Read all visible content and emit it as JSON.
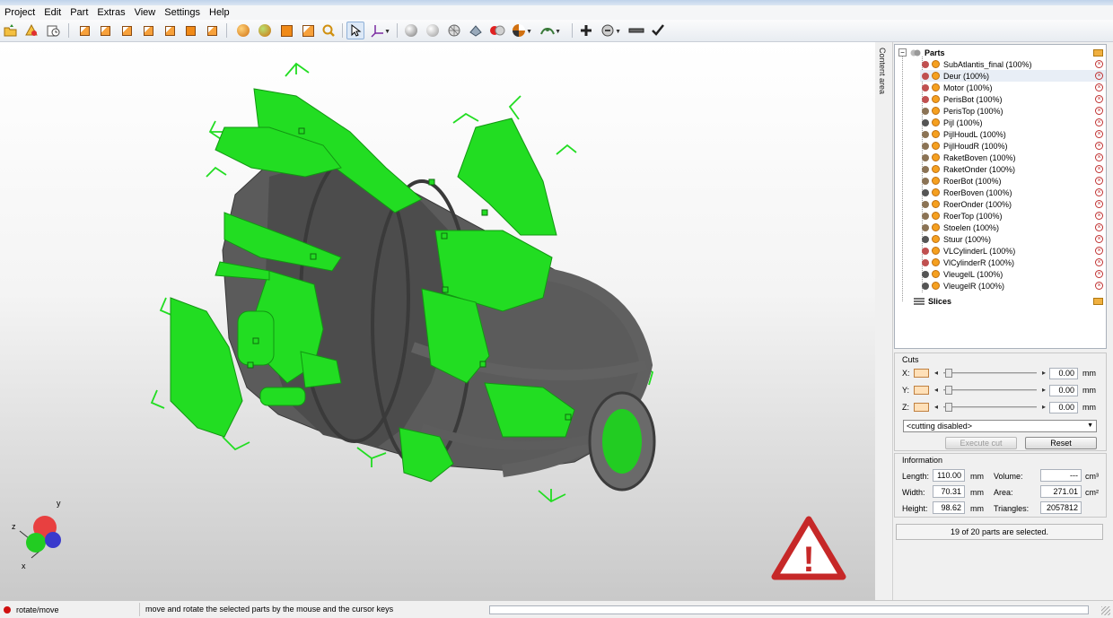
{
  "menu": [
    "Project",
    "Edit",
    "Part",
    "Extras",
    "View",
    "Settings",
    "Help"
  ],
  "toolbar": {
    "buttons": [
      "open-project-icon",
      "add-part-icon",
      "save-icon",
      "view-front-icon",
      "view-back-icon",
      "view-left-icon",
      "view-right-icon",
      "view-top-icon",
      "view-bottom-icon",
      "view-iso-icon",
      "zoom-all-icon",
      "zoom-parts-icon",
      "zoom-selected-icon",
      "zoom-window-icon",
      "magnifier-icon",
      "select-cursor-icon",
      "axis-tool-icon",
      "render-shaded-icon",
      "render-smooth-icon",
      "render-mesh-icon",
      "render-points-icon",
      "render-color-icon",
      "render-mode-icon",
      "measure-icon",
      "add-icon",
      "repair-icon",
      "minus-icon",
      "checkmark-icon"
    ]
  },
  "side_tab": "Content area",
  "tree": {
    "parts_label": "Parts",
    "slices_label": "Slices",
    "parts": [
      {
        "name": "SubAtlantis_final (100%)",
        "cut": true
      },
      {
        "name": "Deur (100%)",
        "cut": true,
        "selected": true
      },
      {
        "name": "Motor (100%)",
        "cut": true
      },
      {
        "name": "PerisBot (100%)",
        "cut": true
      },
      {
        "name": "PerisTop (100%)"
      },
      {
        "name": "Pijl (100%)",
        "dark": true
      },
      {
        "name": "PijlHoudL (100%)"
      },
      {
        "name": "PijlHoudR (100%)"
      },
      {
        "name": "RaketBoven (100%)"
      },
      {
        "name": "RaketOnder (100%)"
      },
      {
        "name": "RoerBot (100%)"
      },
      {
        "name": "RoerBoven (100%)",
        "dark": true
      },
      {
        "name": "RoerOnder (100%)"
      },
      {
        "name": "RoerTop (100%)"
      },
      {
        "name": "Stoelen (100%)"
      },
      {
        "name": "Stuur (100%)",
        "dark": true
      },
      {
        "name": "VLCylinderL (100%)",
        "cut": true
      },
      {
        "name": "VlCylinderR (100%)",
        "cut": true
      },
      {
        "name": "VleugelL (100%)",
        "dark": true
      },
      {
        "name": "VleugelR (100%)",
        "dark": true
      }
    ]
  },
  "cuts": {
    "title": "Cuts",
    "rows": [
      {
        "axis": "X:",
        "value": "0.00",
        "unit": "mm"
      },
      {
        "axis": "Y:",
        "value": "0.00",
        "unit": "mm"
      },
      {
        "axis": "Z:",
        "value": "0.00",
        "unit": "mm"
      }
    ],
    "mode": "<cutting disabled>",
    "execute_label": "Execute cut",
    "reset_label": "Reset"
  },
  "info": {
    "title": "Information",
    "length_label": "Length:",
    "length": "110.00",
    "length_unit": "mm",
    "width_label": "Width:",
    "width": "70.31",
    "width_unit": "mm",
    "height_label": "Height:",
    "height": "98.62",
    "height_unit": "mm",
    "volume_label": "Volume:",
    "volume": "---",
    "volume_unit": "cm³",
    "area_label": "Area:",
    "area": "271.01",
    "area_unit": "cm²",
    "triangles_label": "Triangles:",
    "triangles": "2057812"
  },
  "selection_status": "19 of 20 parts are selected.",
  "viewport": {
    "axis_x": "x",
    "axis_y": "y",
    "axis_z": "z",
    "warning_symbol": "!",
    "colors": {
      "selected": "#22dd22",
      "model": "#5b5b5b",
      "warning": "#c62828"
    }
  },
  "status": {
    "mode": "rotate/move",
    "message": "move and rotate the selected parts by the mouse and the cursor keys"
  }
}
